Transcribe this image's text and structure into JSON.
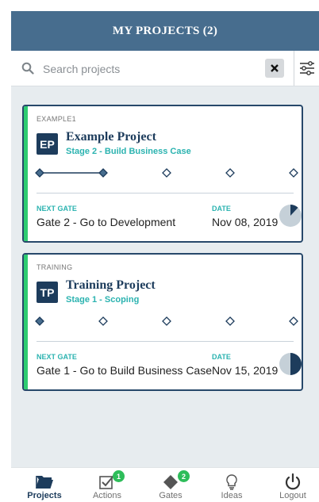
{
  "header": {
    "title": "MY PROJECTS (2)"
  },
  "search": {
    "placeholder": "Search projects",
    "value": ""
  },
  "projects": [
    {
      "tag": "EXAMPLE1",
      "badge": "EP",
      "name": "Example Project",
      "stage": "Stage 2 - Build Business Case",
      "completed_gates": 1,
      "total_gates": 5,
      "next_gate_label": "NEXT GATE",
      "next_gate": "Gate 2 - Go to Development",
      "date_label": "DATE",
      "date": "Nov 08, 2019",
      "progress_fraction": 0.12
    },
    {
      "tag": "TRAINING",
      "badge": "TP",
      "name": "Training Project",
      "stage": "Stage 1 - Scoping",
      "completed_gates": 0,
      "total_gates": 5,
      "next_gate_label": "NEXT GATE",
      "next_gate": "Gate 1 - Go to Build Business Case",
      "date_label": "DATE",
      "date": "Nov 15, 2019",
      "progress_fraction": 0.5
    }
  ],
  "tabs": [
    {
      "label": "Projects",
      "icon": "folder-icon",
      "active": true
    },
    {
      "label": "Actions",
      "icon": "checkbox-icon",
      "badge": "1"
    },
    {
      "label": "Gates",
      "icon": "diamond-icon",
      "badge": "2"
    },
    {
      "label": "Ideas",
      "icon": "lightbulb-icon"
    },
    {
      "label": "Logout",
      "icon": "power-icon"
    }
  ],
  "colors": {
    "header": "#476d8e",
    "navy": "#1d3c5c",
    "teal": "#2bb3b0",
    "accent_green": "#2ecc71",
    "pie_bg": "#c5d0d8"
  }
}
